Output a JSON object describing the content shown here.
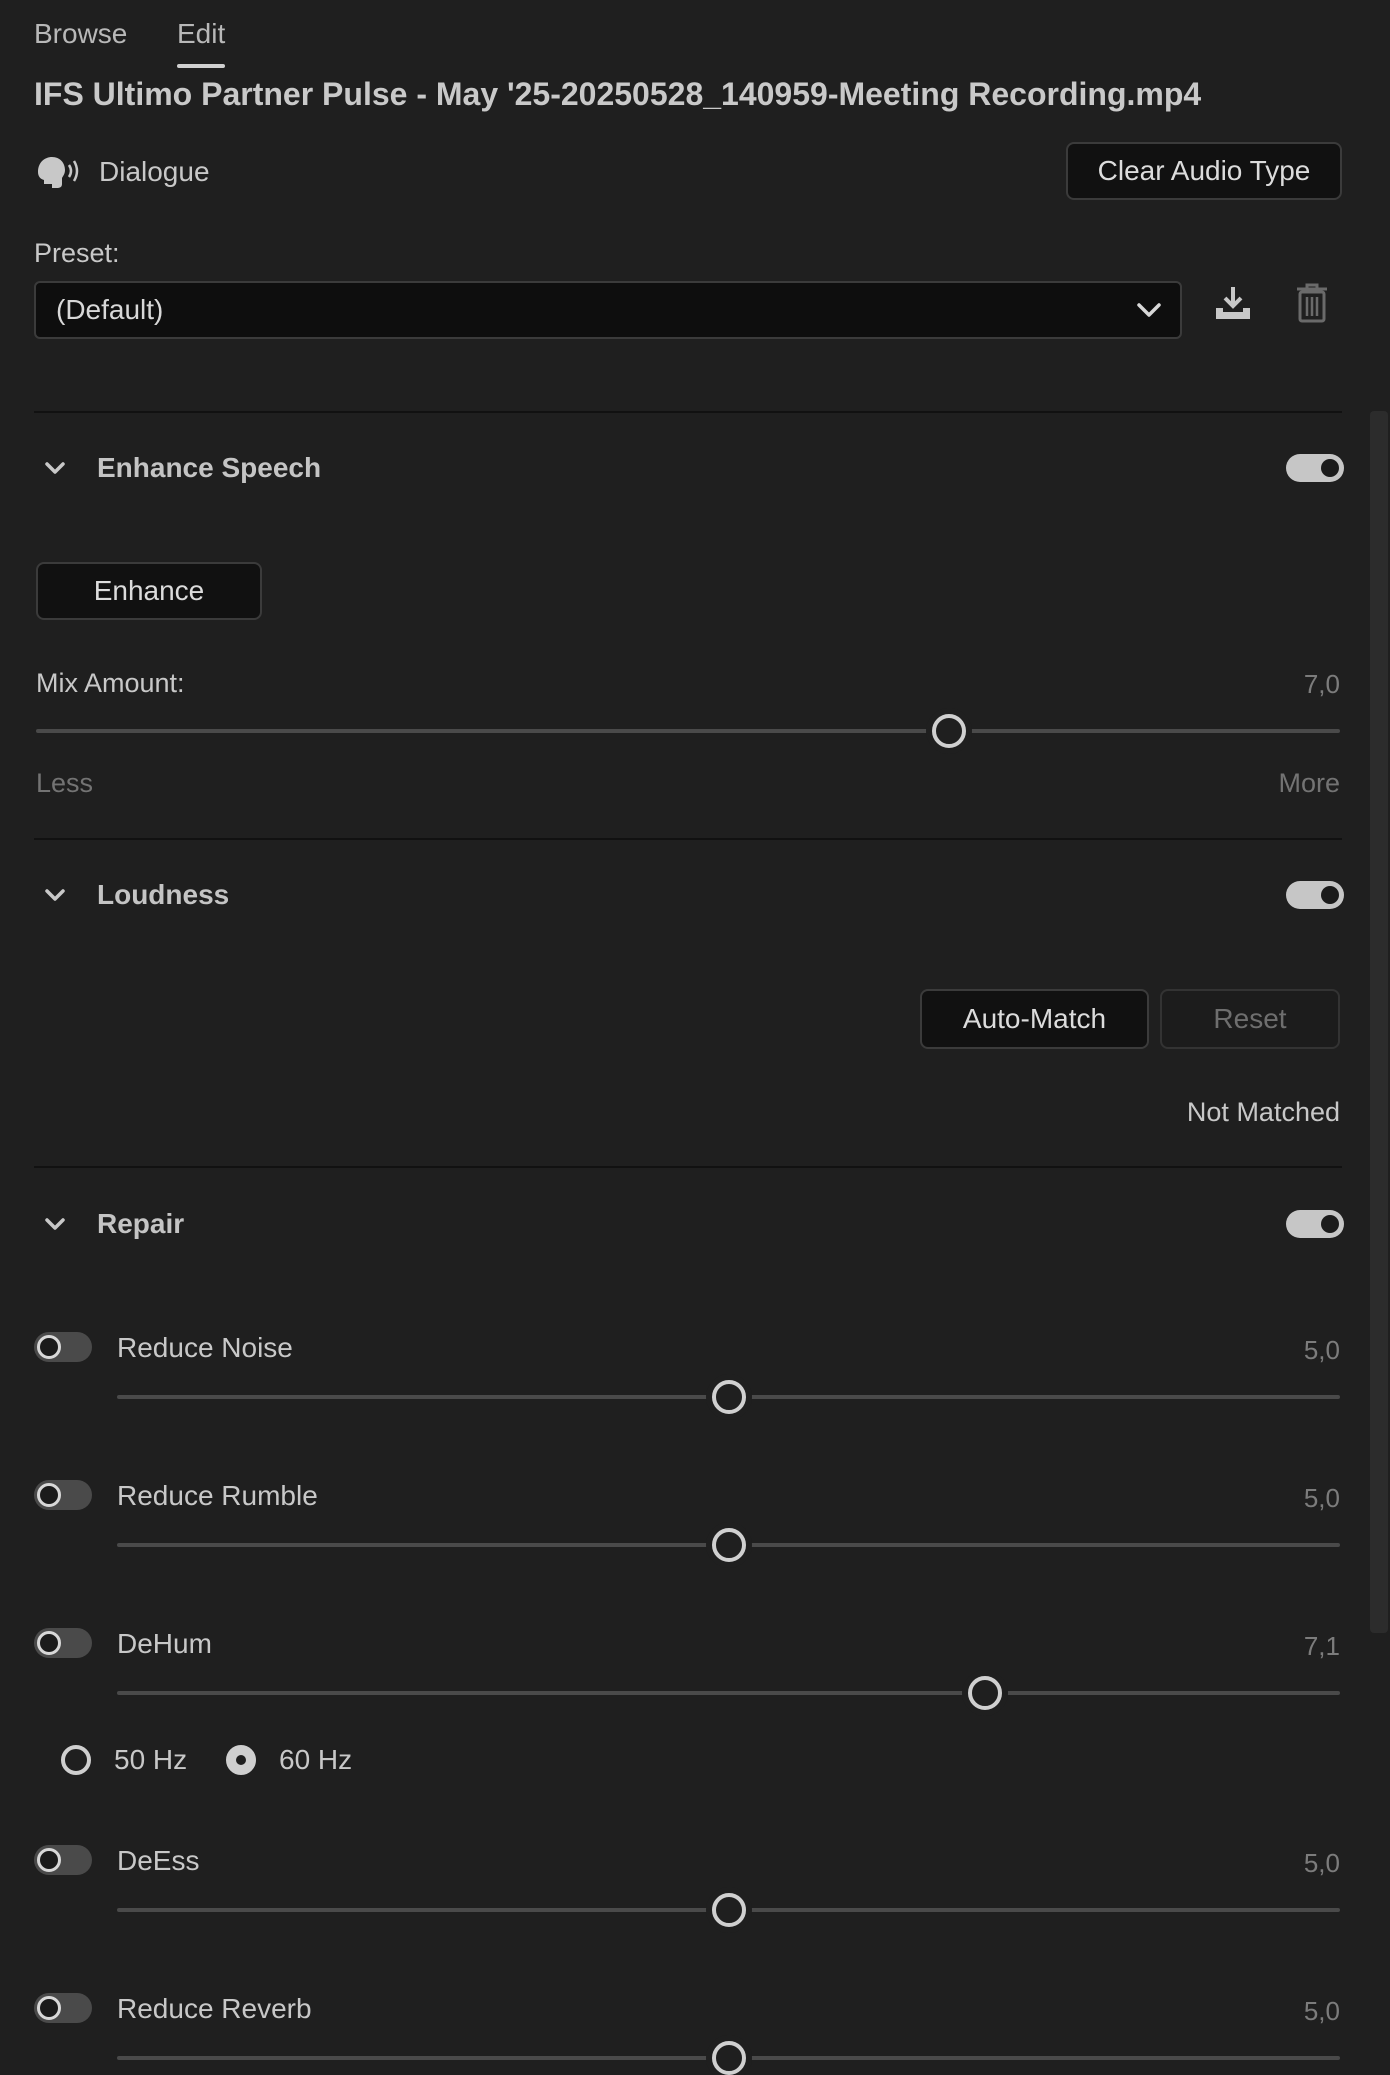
{
  "tabs": [
    {
      "label": "Browse",
      "active": false
    },
    {
      "label": "Edit",
      "active": true
    }
  ],
  "file_title": "IFS Ultimo Partner Pulse - May '25-20250528_140959-Meeting Recording.mp4",
  "audio_type": {
    "icon": "speaking-head-icon",
    "label": "Dialogue",
    "clear_button": "Clear Audio Type"
  },
  "preset": {
    "label": "Preset:",
    "selected": "(Default)",
    "save_icon": "save-preset-icon",
    "delete_icon": "trash-icon"
  },
  "enhance_speech": {
    "title": "Enhance Speech",
    "enabled": true,
    "enhance_button": "Enhance",
    "mix_label": "Mix Amount:",
    "mix_value": "7,0",
    "mix_fraction": 0.7,
    "less_label": "Less",
    "more_label": "More"
  },
  "loudness": {
    "title": "Loudness",
    "enabled": true,
    "auto_match_button": "Auto-Match",
    "reset_button": "Reset",
    "status": "Not Matched"
  },
  "repair": {
    "title": "Repair",
    "enabled": true,
    "items": [
      {
        "label": "Reduce Noise",
        "value": "5,0",
        "fraction": 0.5,
        "enabled": false
      },
      {
        "label": "Reduce Rumble",
        "value": "5,0",
        "fraction": 0.5,
        "enabled": false
      },
      {
        "label": "DeHum",
        "value": "7,1",
        "fraction": 0.71,
        "enabled": false
      },
      {
        "label": "DeEss",
        "value": "5,0",
        "fraction": 0.5,
        "enabled": false
      },
      {
        "label": "Reduce Reverb",
        "value": "5,0",
        "fraction": 0.5,
        "enabled": false
      }
    ],
    "hum_options": [
      {
        "label": "50 Hz",
        "checked": false
      },
      {
        "label": "60 Hz",
        "checked": true
      }
    ]
  },
  "colors": {
    "background": "#1f1f1f",
    "text": "#c8c8c8",
    "muted": "#737373"
  }
}
